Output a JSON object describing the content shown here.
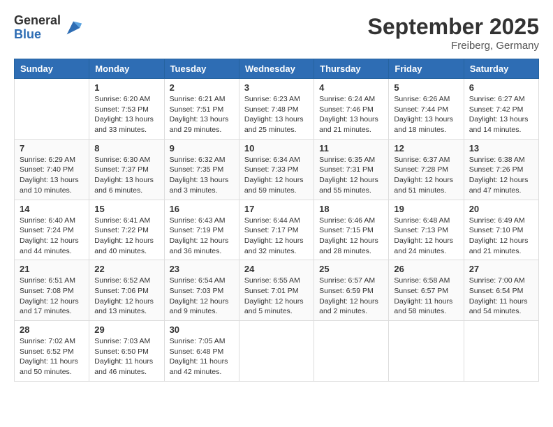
{
  "logo": {
    "general": "General",
    "blue": "Blue"
  },
  "header": {
    "month": "September 2025",
    "location": "Freiberg, Germany"
  },
  "weekdays": [
    "Sunday",
    "Monday",
    "Tuesday",
    "Wednesday",
    "Thursday",
    "Friday",
    "Saturday"
  ],
  "weeks": [
    [
      {
        "day": "",
        "sunrise": "",
        "sunset": "",
        "daylight": ""
      },
      {
        "day": "1",
        "sunrise": "Sunrise: 6:20 AM",
        "sunset": "Sunset: 7:53 PM",
        "daylight": "Daylight: 13 hours and 33 minutes."
      },
      {
        "day": "2",
        "sunrise": "Sunrise: 6:21 AM",
        "sunset": "Sunset: 7:51 PM",
        "daylight": "Daylight: 13 hours and 29 minutes."
      },
      {
        "day": "3",
        "sunrise": "Sunrise: 6:23 AM",
        "sunset": "Sunset: 7:48 PM",
        "daylight": "Daylight: 13 hours and 25 minutes."
      },
      {
        "day": "4",
        "sunrise": "Sunrise: 6:24 AM",
        "sunset": "Sunset: 7:46 PM",
        "daylight": "Daylight: 13 hours and 21 minutes."
      },
      {
        "day": "5",
        "sunrise": "Sunrise: 6:26 AM",
        "sunset": "Sunset: 7:44 PM",
        "daylight": "Daylight: 13 hours and 18 minutes."
      },
      {
        "day": "6",
        "sunrise": "Sunrise: 6:27 AM",
        "sunset": "Sunset: 7:42 PM",
        "daylight": "Daylight: 13 hours and 14 minutes."
      }
    ],
    [
      {
        "day": "7",
        "sunrise": "Sunrise: 6:29 AM",
        "sunset": "Sunset: 7:40 PM",
        "daylight": "Daylight: 13 hours and 10 minutes."
      },
      {
        "day": "8",
        "sunrise": "Sunrise: 6:30 AM",
        "sunset": "Sunset: 7:37 PM",
        "daylight": "Daylight: 13 hours and 6 minutes."
      },
      {
        "day": "9",
        "sunrise": "Sunrise: 6:32 AM",
        "sunset": "Sunset: 7:35 PM",
        "daylight": "Daylight: 13 hours and 3 minutes."
      },
      {
        "day": "10",
        "sunrise": "Sunrise: 6:34 AM",
        "sunset": "Sunset: 7:33 PM",
        "daylight": "Daylight: 12 hours and 59 minutes."
      },
      {
        "day": "11",
        "sunrise": "Sunrise: 6:35 AM",
        "sunset": "Sunset: 7:31 PM",
        "daylight": "Daylight: 12 hours and 55 minutes."
      },
      {
        "day": "12",
        "sunrise": "Sunrise: 6:37 AM",
        "sunset": "Sunset: 7:28 PM",
        "daylight": "Daylight: 12 hours and 51 minutes."
      },
      {
        "day": "13",
        "sunrise": "Sunrise: 6:38 AM",
        "sunset": "Sunset: 7:26 PM",
        "daylight": "Daylight: 12 hours and 47 minutes."
      }
    ],
    [
      {
        "day": "14",
        "sunrise": "Sunrise: 6:40 AM",
        "sunset": "Sunset: 7:24 PM",
        "daylight": "Daylight: 12 hours and 44 minutes."
      },
      {
        "day": "15",
        "sunrise": "Sunrise: 6:41 AM",
        "sunset": "Sunset: 7:22 PM",
        "daylight": "Daylight: 12 hours and 40 minutes."
      },
      {
        "day": "16",
        "sunrise": "Sunrise: 6:43 AM",
        "sunset": "Sunset: 7:19 PM",
        "daylight": "Daylight: 12 hours and 36 minutes."
      },
      {
        "day": "17",
        "sunrise": "Sunrise: 6:44 AM",
        "sunset": "Sunset: 7:17 PM",
        "daylight": "Daylight: 12 hours and 32 minutes."
      },
      {
        "day": "18",
        "sunrise": "Sunrise: 6:46 AM",
        "sunset": "Sunset: 7:15 PM",
        "daylight": "Daylight: 12 hours and 28 minutes."
      },
      {
        "day": "19",
        "sunrise": "Sunrise: 6:48 AM",
        "sunset": "Sunset: 7:13 PM",
        "daylight": "Daylight: 12 hours and 24 minutes."
      },
      {
        "day": "20",
        "sunrise": "Sunrise: 6:49 AM",
        "sunset": "Sunset: 7:10 PM",
        "daylight": "Daylight: 12 hours and 21 minutes."
      }
    ],
    [
      {
        "day": "21",
        "sunrise": "Sunrise: 6:51 AM",
        "sunset": "Sunset: 7:08 PM",
        "daylight": "Daylight: 12 hours and 17 minutes."
      },
      {
        "day": "22",
        "sunrise": "Sunrise: 6:52 AM",
        "sunset": "Sunset: 7:06 PM",
        "daylight": "Daylight: 12 hours and 13 minutes."
      },
      {
        "day": "23",
        "sunrise": "Sunrise: 6:54 AM",
        "sunset": "Sunset: 7:03 PM",
        "daylight": "Daylight: 12 hours and 9 minutes."
      },
      {
        "day": "24",
        "sunrise": "Sunrise: 6:55 AM",
        "sunset": "Sunset: 7:01 PM",
        "daylight": "Daylight: 12 hours and 5 minutes."
      },
      {
        "day": "25",
        "sunrise": "Sunrise: 6:57 AM",
        "sunset": "Sunset: 6:59 PM",
        "daylight": "Daylight: 12 hours and 2 minutes."
      },
      {
        "day": "26",
        "sunrise": "Sunrise: 6:58 AM",
        "sunset": "Sunset: 6:57 PM",
        "daylight": "Daylight: 11 hours and 58 minutes."
      },
      {
        "day": "27",
        "sunrise": "Sunrise: 7:00 AM",
        "sunset": "Sunset: 6:54 PM",
        "daylight": "Daylight: 11 hours and 54 minutes."
      }
    ],
    [
      {
        "day": "28",
        "sunrise": "Sunrise: 7:02 AM",
        "sunset": "Sunset: 6:52 PM",
        "daylight": "Daylight: 11 hours and 50 minutes."
      },
      {
        "day": "29",
        "sunrise": "Sunrise: 7:03 AM",
        "sunset": "Sunset: 6:50 PM",
        "daylight": "Daylight: 11 hours and 46 minutes."
      },
      {
        "day": "30",
        "sunrise": "Sunrise: 7:05 AM",
        "sunset": "Sunset: 6:48 PM",
        "daylight": "Daylight: 11 hours and 42 minutes."
      },
      {
        "day": "",
        "sunrise": "",
        "sunset": "",
        "daylight": ""
      },
      {
        "day": "",
        "sunrise": "",
        "sunset": "",
        "daylight": ""
      },
      {
        "day": "",
        "sunrise": "",
        "sunset": "",
        "daylight": ""
      },
      {
        "day": "",
        "sunrise": "",
        "sunset": "",
        "daylight": ""
      }
    ]
  ]
}
